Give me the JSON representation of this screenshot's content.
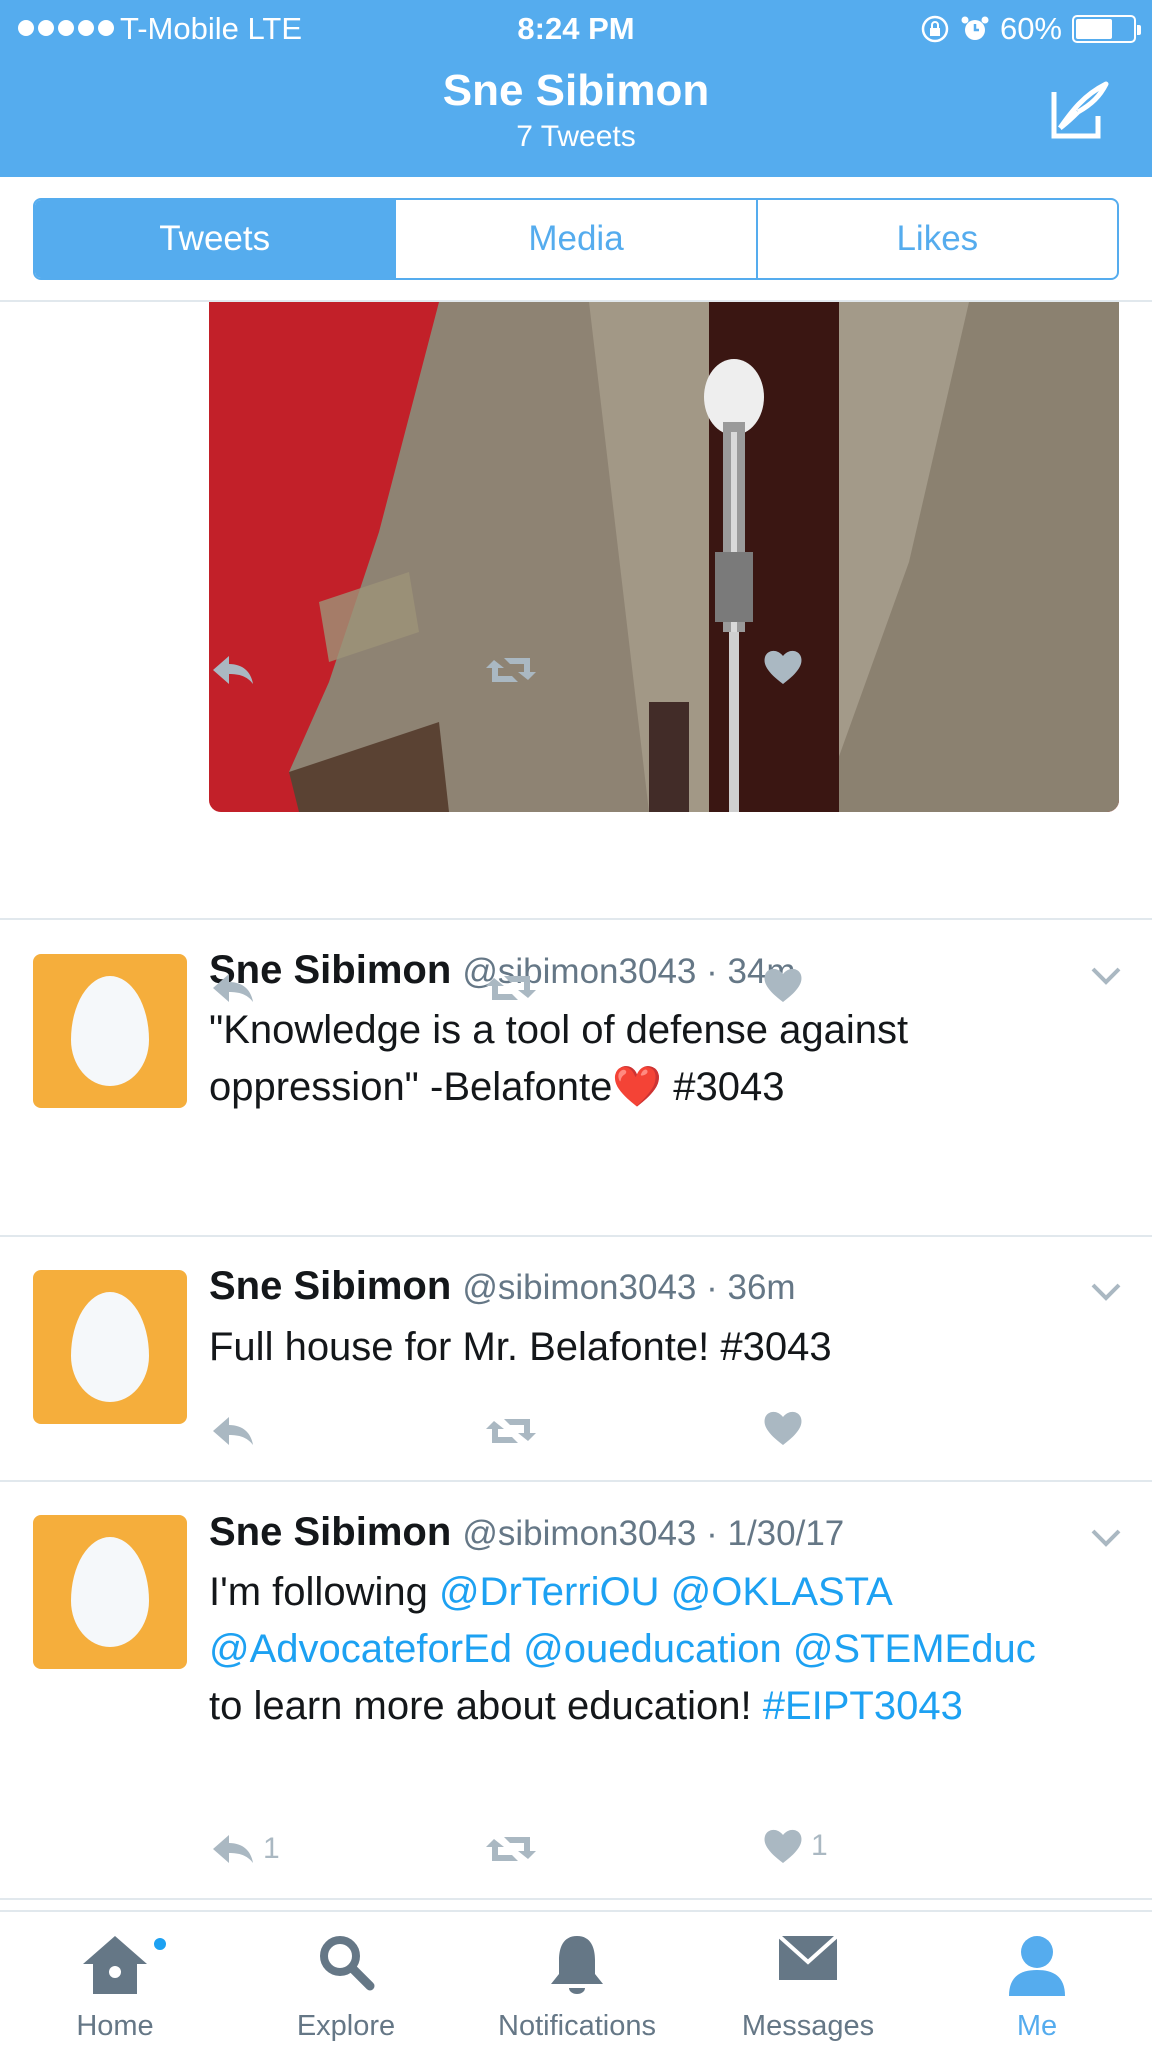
{
  "status_bar": {
    "carrier": "T-Mobile  LTE",
    "time": "8:24 PM",
    "battery_text": "60%",
    "battery_level": 0.6
  },
  "nav": {
    "title": "Sne Sibimon",
    "subtitle": "7 Tweets",
    "compose_icon": "compose-icon"
  },
  "segments": [
    {
      "label": "Tweets",
      "active": true
    },
    {
      "label": "Media",
      "active": false
    },
    {
      "label": "Likes",
      "active": false
    }
  ],
  "tweets": [
    {
      "name": "Sne Sibimon",
      "handle": "@sibimon3043",
      "time": "34m",
      "text_part1": "\"Knowledge is a tool of defense against oppression\" -Belafonte",
      "emoji": "❤️",
      "text_part2": " #3043"
    },
    {
      "name": "Sne Sibimon",
      "handle": "@sibimon3043",
      "time": "36m",
      "text": "Full house for Mr. Belafonte! #3043"
    },
    {
      "name": "Sne Sibimon",
      "handle": "@sibimon3043",
      "time": "1/30/17",
      "text_intro": "I'm following ",
      "mentions": [
        "@DrTerriOU",
        "@OKLASTA",
        "@AdvocateforEd",
        "@oueducation",
        "@STEMEduc"
      ],
      "text_mid": " to learn more about education! ",
      "hashtag": "#EIPT3043",
      "reply_count": "1",
      "like_count": "1"
    }
  ],
  "tabbar": [
    {
      "label": "Home",
      "icon": "home-icon",
      "active": false,
      "has_badge": true
    },
    {
      "label": "Explore",
      "icon": "search-icon",
      "active": false
    },
    {
      "label": "Notifications",
      "icon": "bell-icon",
      "active": false
    },
    {
      "label": "Messages",
      "icon": "envelope-icon",
      "active": false
    },
    {
      "label": "Me",
      "icon": "person-icon",
      "active": true
    }
  ],
  "colors": {
    "brand_blue": "#55acee",
    "link_blue": "#1da1f2",
    "avatar_orange": "#f5ae3c",
    "action_gray": "#aab8c2"
  }
}
